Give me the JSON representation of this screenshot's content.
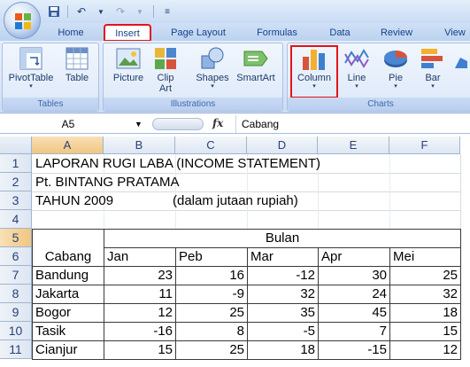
{
  "qat": {
    "undo_icon": "undo-icon",
    "redo_icon": "redo-icon",
    "save_icon": "save-icon"
  },
  "tabs": [
    {
      "label": "Home"
    },
    {
      "label": "Insert"
    },
    {
      "label": "Page Layout"
    },
    {
      "label": "Formulas"
    },
    {
      "label": "Data"
    },
    {
      "label": "Review"
    },
    {
      "label": "View"
    }
  ],
  "ribbon": {
    "groups": {
      "tables": "Tables",
      "illustrations": "Illustrations",
      "charts": "Charts"
    },
    "buttons": {
      "pivottable": "PivotTable",
      "table": "Table",
      "picture": "Picture",
      "clipart": "Clip Art",
      "shapes": "Shapes",
      "smartart": "SmartArt",
      "column": "Column",
      "line": "Line",
      "pie": "Pie",
      "bar": "Bar"
    },
    "highlight_color": "#e3141b"
  },
  "formula_bar": {
    "namebox": "A5",
    "fx": "fx",
    "content": "Cabang"
  },
  "columns": [
    "A",
    "B",
    "C",
    "D",
    "E",
    "F"
  ],
  "rows": [
    "1",
    "2",
    "3",
    "4",
    "5",
    "6",
    "7",
    "8",
    "9",
    "10",
    "11"
  ],
  "sheet": {
    "title1": "LAPORAN RUGI LABA (INCOME STATEMENT)",
    "title2": "Pt. BINTANG PRATAMA",
    "year": "TAHUN 2009",
    "unit": "(dalam jutaan rupiah)",
    "header_cabang": "Cabang",
    "header_bulan": "Bulan",
    "months": [
      "Jan",
      "Peb",
      "Mar",
      "Apr",
      "Mei"
    ],
    "data": [
      {
        "cabang": "Bandung",
        "values": [
          "23",
          "16",
          "-12",
          "30",
          "25"
        ]
      },
      {
        "cabang": "Jakarta",
        "values": [
          "11",
          "-9",
          "32",
          "24",
          "32"
        ]
      },
      {
        "cabang": "Bogor",
        "values": [
          "12",
          "25",
          "35",
          "45",
          "18"
        ]
      },
      {
        "cabang": "Tasik",
        "values": [
          "-16",
          "8",
          "-5",
          "7",
          "15"
        ]
      },
      {
        "cabang": "Cianjur",
        "values": [
          "15",
          "25",
          "18",
          "-15",
          "12"
        ]
      }
    ]
  }
}
